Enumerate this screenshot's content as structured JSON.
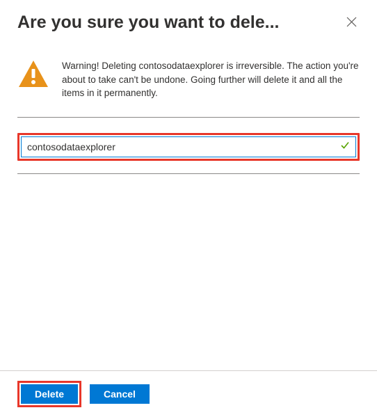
{
  "dialog": {
    "title": "Are you sure you want to dele...",
    "resource_name": "contosodataexplorer",
    "warning_text": "Warning! Deleting contosodataexplorer is irreversible. The action you're about to take can't be undone. Going further will delete it and all the items in it permanently.",
    "input_value": "contosodataexplorer",
    "buttons": {
      "delete": "Delete",
      "cancel": "Cancel"
    }
  },
  "colors": {
    "primary": "#0078d4",
    "warning_icon": "#e8921a",
    "highlight_border": "#e8372a",
    "success_check": "#57a300"
  }
}
